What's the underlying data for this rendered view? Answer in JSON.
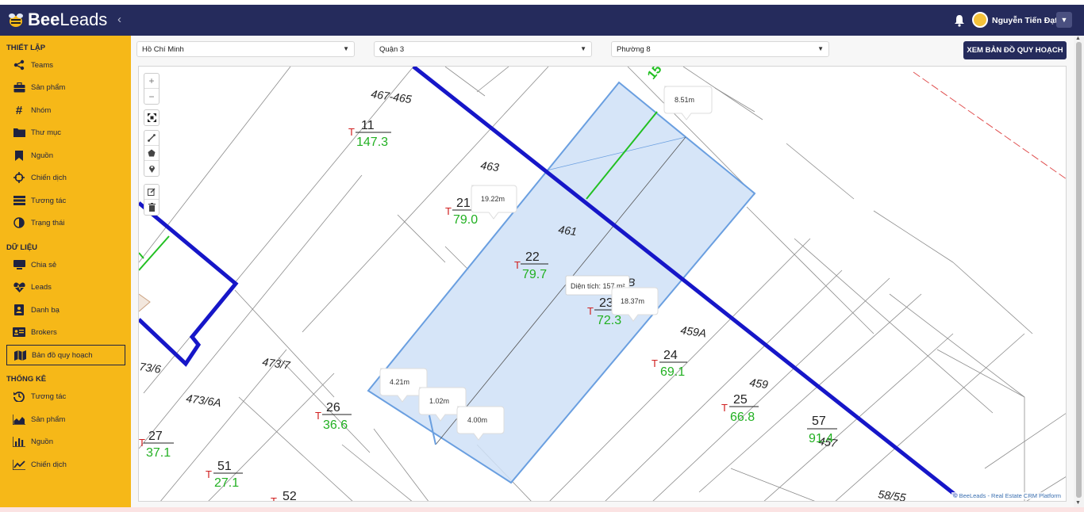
{
  "app": {
    "logo_bold": "Bee",
    "logo_light": "Leads",
    "collapse_icon": "chevron-left-icon"
  },
  "header": {
    "user_name": "Nguyễn Tiến Đạt",
    "notification_icon": "bell-icon"
  },
  "sidebar": {
    "sections": [
      {
        "title": "THIẾT LẬP",
        "items": [
          {
            "label": "Teams",
            "icon": "share-icon"
          },
          {
            "label": "Sản phẩm",
            "icon": "briefcase-icon"
          },
          {
            "label": "Nhóm",
            "icon": "hashtag-icon"
          },
          {
            "label": "Thư mục",
            "icon": "folder-icon"
          },
          {
            "label": "Nguồn",
            "icon": "bookmark-icon"
          },
          {
            "label": "Chiến dịch",
            "icon": "crosshair-icon"
          },
          {
            "label": "Tương tác",
            "icon": "list-icon"
          },
          {
            "label": "Trạng thái",
            "icon": "half-circle-icon"
          }
        ]
      },
      {
        "title": "DỮ LIỆU",
        "items": [
          {
            "label": "Chia sẻ",
            "icon": "share-screen-icon"
          },
          {
            "label": "Leads",
            "icon": "heartbeat-icon"
          },
          {
            "label": "Danh bạ",
            "icon": "contact-book-icon"
          },
          {
            "label": "Brokers",
            "icon": "id-card-icon"
          },
          {
            "label": "Bản đồ quy hoạch",
            "icon": "map-icon",
            "active": true
          }
        ]
      },
      {
        "title": "THỐNG KÊ",
        "items": [
          {
            "label": "Tương tác",
            "icon": "history-icon"
          },
          {
            "label": "Sản phẩm",
            "icon": "area-chart-icon"
          },
          {
            "label": "Nguồn",
            "icon": "bar-chart-icon"
          },
          {
            "label": "Chiến dịch",
            "icon": "line-chart-icon"
          }
        ]
      }
    ]
  },
  "filters": {
    "city": "Hồ Chí Minh",
    "district": "Quận 3",
    "ward": "Phường 8",
    "view_button": "XEM BẢN ĐỒ QUY HOẠCH"
  },
  "map": {
    "zoom_in": "+",
    "zoom_out": "−",
    "attribution": "© BeeLeads - Real Estate CRM Platform",
    "area_tooltip": "Diện tích: 157 m²",
    "measurements": [
      "8.51m",
      "19.22m",
      "18.37m",
      "4.21m",
      "1.02m",
      "4.00m"
    ],
    "lot_labels": [
      "467-465",
      "463",
      "461",
      "459A",
      "459",
      "473/7",
      "473/6A",
      "73/6",
      "457",
      "58/55"
    ],
    "parcels": [
      {
        "no": "11",
        "area": "147.3"
      },
      {
        "no": "21",
        "area": "79.0"
      },
      {
        "no": "22",
        "area": "79.7"
      },
      {
        "no": "23",
        "area": "72.3"
      },
      {
        "no": "24",
        "area": "69.1"
      },
      {
        "no": "25",
        "area": "66.8"
      },
      {
        "no": "26",
        "area": "36.6"
      },
      {
        "no": "27",
        "area": "37.1"
      },
      {
        "no": "51",
        "area": "27.1"
      },
      {
        "no": "57",
        "area": "91.4"
      },
      {
        "no": "52",
        "area": ""
      }
    ],
    "parcel_marker": "T",
    "fragment_text": "B",
    "top_fragment": "15"
  }
}
